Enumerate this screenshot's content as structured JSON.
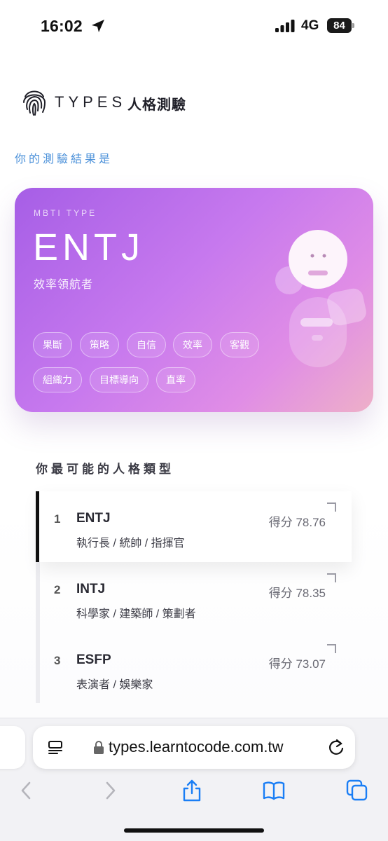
{
  "status_bar": {
    "time": "16:02",
    "network": "4G",
    "battery": "84"
  },
  "brand": {
    "name": "TYPES",
    "subtitle": "人格測驗"
  },
  "result_label": "你的測驗結果是",
  "card": {
    "kicker": "MBTI TYPE",
    "type": "ENTJ",
    "nickname": "效率領航者",
    "tags": [
      "果斷",
      "策略",
      "自信",
      "效率",
      "客觀",
      "組織力",
      "目標導向",
      "直率"
    ]
  },
  "ranking": {
    "title": "你最可能的人格類型",
    "items": [
      {
        "rank": "1",
        "type": "ENTJ",
        "roles": "執行長 / 統帥 / 指揮官",
        "score": "得分 78.76"
      },
      {
        "rank": "2",
        "type": "INTJ",
        "roles": "科學家 / 建築師 / 策劃者",
        "score": "得分 78.35"
      },
      {
        "rank": "3",
        "type": "ESFP",
        "roles": "表演者 / 娛樂家",
        "score": "得分 73.07"
      }
    ]
  },
  "browser": {
    "url": "types.learntocode.com.tw"
  },
  "colors": {
    "accent_blue": "#4a90d9",
    "card_start": "#a65ee6",
    "card_end": "#eeb0c8",
    "ios_blue": "#1a7ef5"
  },
  "icons": [
    "location-arrow-icon",
    "signal-icon",
    "battery-icon",
    "fingerprint-logo-icon",
    "reader-mode-icon",
    "lock-icon",
    "reload-icon",
    "back-icon",
    "forward-icon",
    "share-icon",
    "bookmarks-icon",
    "tabs-icon"
  ]
}
